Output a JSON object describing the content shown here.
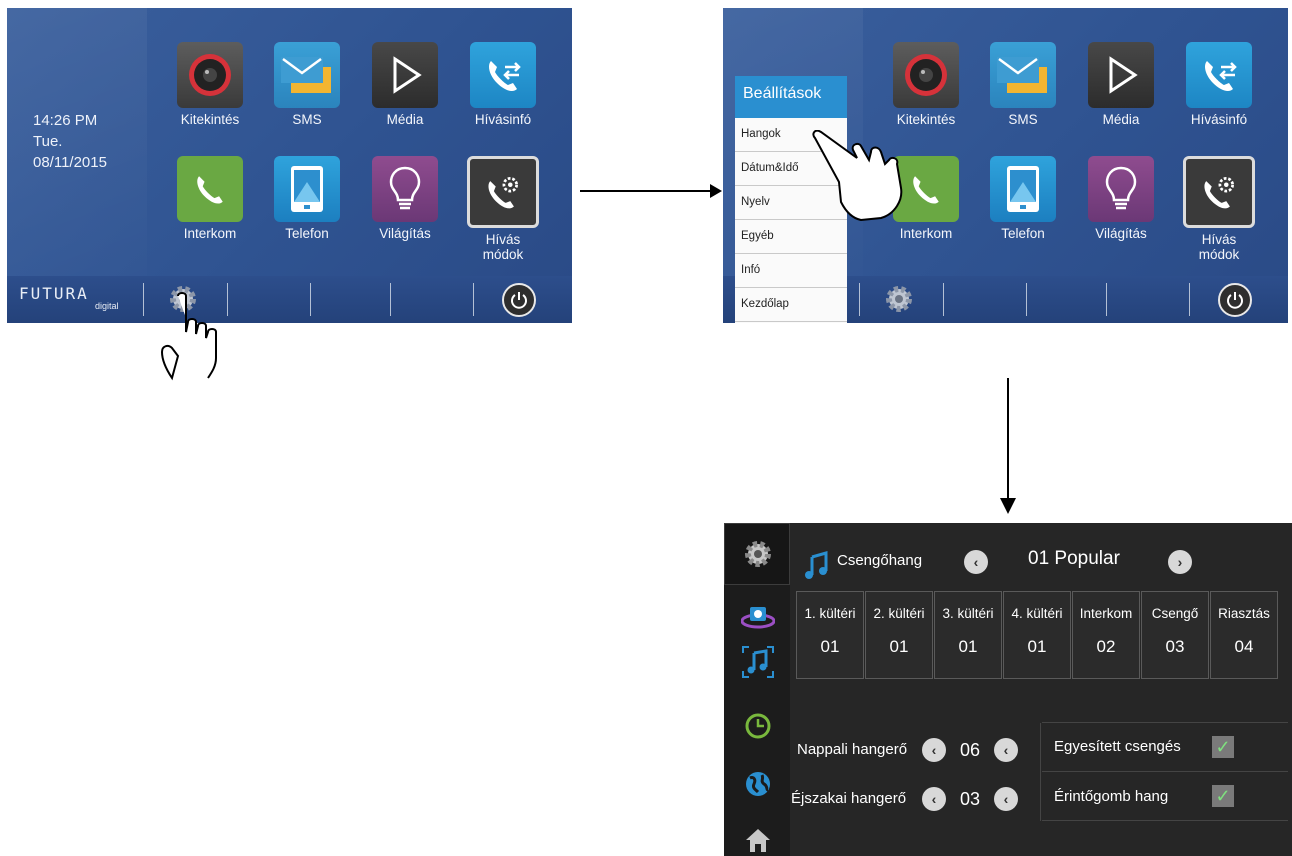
{
  "home": {
    "clock_time": "14:26  PM",
    "clock_day": "Tue.",
    "clock_date": "08/11/2015",
    "apps": [
      {
        "label": "Kitekintés",
        "icon": "camera-icon"
      },
      {
        "label": "SMS",
        "icon": "message-icon"
      },
      {
        "label": "Média",
        "icon": "play-icon"
      },
      {
        "label": "Hívásinfó",
        "icon": "call-info-icon"
      },
      {
        "label": "Interkom",
        "icon": "phone-icon"
      },
      {
        "label": "Telefon",
        "icon": "tablet-icon"
      },
      {
        "label": "Világítás",
        "icon": "bulb-icon"
      },
      {
        "label": "Hívás\nmódok",
        "label_line1": "Hívás",
        "label_line2": "módok",
        "icon": "call-settings-icon"
      }
    ],
    "logo_main": "FUTURA",
    "logo_sub": "digital"
  },
  "settings_menu": {
    "title": "Beállítások",
    "items": [
      "Hangok",
      "Dátum&Idő",
      "Nyelv",
      "Egyéb",
      "Infó",
      "Kezdőlap"
    ]
  },
  "sound_settings": {
    "ringtone_label": "Csengőhang",
    "ringtone_value": "01 Popular",
    "columns": [
      {
        "label": "1. kültéri",
        "value": "01"
      },
      {
        "label": "2. kültéri",
        "value": "01"
      },
      {
        "label": "3. kültéri",
        "value": "01"
      },
      {
        "label": "4. kültéri",
        "value": "01"
      },
      {
        "label": "Interkom",
        "value": "02"
      },
      {
        "label": "Csengő",
        "value": "03"
      },
      {
        "label": "Riasztás",
        "value": "04"
      }
    ],
    "day_volume_label": "Nappali hangerő",
    "day_volume_value": "06",
    "night_volume_label": "Éjszakai hangerő",
    "night_volume_value": "03",
    "unified_ring_label": "Egyesített csengés",
    "unified_ring_checked": true,
    "touch_sound_label": "Érintőgomb hang",
    "touch_sound_checked": true
  }
}
